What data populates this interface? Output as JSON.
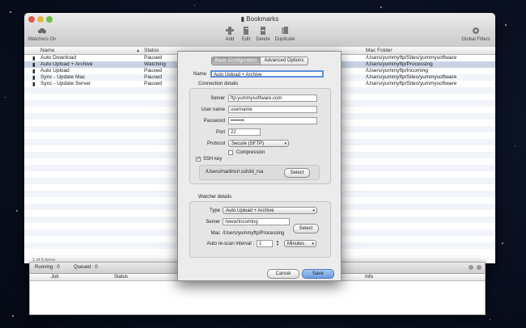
{
  "window": {
    "title": "Bookmarks",
    "watchers_label": "Watchers On",
    "global_filters_label": "Global Filters",
    "toolbar": {
      "add": "Add",
      "edit": "Edit",
      "delete": "Delete",
      "duplicate": "Duplicate"
    }
  },
  "table": {
    "columns": {
      "name": "Name",
      "status": "Status",
      "mac_folder": "Mac Folder"
    },
    "rows": [
      {
        "name": "Auto Download",
        "status": "Paused",
        "folder": "/Users/yummyftp/Sites/yummysoftware"
      },
      {
        "name": "Auto Upload + Archive",
        "status": "Watching",
        "folder": "/Users/yummyftp/Processing"
      },
      {
        "name": "Auto Upload",
        "status": "Paused",
        "folder": "/Users/yummyftp/Incoming"
      },
      {
        "name": "Sync - Update Mac",
        "status": "Paused",
        "folder": "/Users/yummyftp/Sites/yummysoftware"
      },
      {
        "name": "Sync - Update Server",
        "status": "Paused",
        "folder": "/Users/yummyftp/Sites/yummysoftware"
      }
    ],
    "footer": "1 of 5 items"
  },
  "queue": {
    "running_label": "Running : 0",
    "queued_label": "Queued : 0",
    "columns": {
      "job": "Job",
      "status": "Status",
      "info": "Info"
    }
  },
  "dialog": {
    "tabs": {
      "basic": "Basic Configuration",
      "advanced": "Advanced Options"
    },
    "name_label": "Name",
    "name_value": "Auto Upload + Archive",
    "connection": {
      "title": "Connection details",
      "server_label": "Server",
      "server_value": "ftp.yummysoftware.com",
      "username_label": "User name",
      "username_value": "username",
      "password_label": "Password",
      "password_value": "••••••••",
      "port_label": "Port",
      "port_value": "22",
      "protocol_label": "Protocol",
      "protocol_value": "Secure (SFTP)",
      "compression_label": "Compression",
      "sshkey_label": "SSH key",
      "sshkey_path": "/Users/martincr/.ssh/id_rsa",
      "select_label": "Select"
    },
    "watcher": {
      "title": "Watcher details",
      "type_label": "Type",
      "type_value": "Auto Upload + Archive",
      "server_label": "Server",
      "server_value": "/www/Incoming",
      "mac_label": "Mac",
      "mac_value": "/Users/yummyftp/Processing",
      "select_label": "Select",
      "rescan_label": "Auto re-scan interval :",
      "rescan_value": "1",
      "rescan_unit": "Minutes"
    },
    "cancel_label": "Cancel",
    "save_label": "Save"
  },
  "colors": {
    "accent": "#5b8fd8",
    "selection": "#c9d3e3",
    "save_button": "#7ba7e6"
  }
}
